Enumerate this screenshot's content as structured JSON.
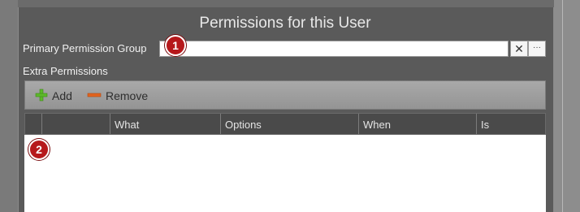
{
  "title": "Permissions for this User",
  "primary_group": {
    "label": "Primary Permission Group",
    "value": "",
    "clear_symbol": "✕",
    "more_symbol": "···"
  },
  "extra_permissions_label": "Extra Permissions",
  "toolbar": {
    "add_label": "Add",
    "remove_label": "Remove",
    "add_icon": "plus-icon",
    "remove_icon": "minus-icon"
  },
  "grid": {
    "columns": [
      "What",
      "Options",
      "When",
      "Is"
    ],
    "rows": []
  },
  "badges": [
    "1",
    "2"
  ],
  "colors": {
    "badge": "#b6181b",
    "add_icon": "#5db82a",
    "remove_icon": "#e2641f"
  }
}
